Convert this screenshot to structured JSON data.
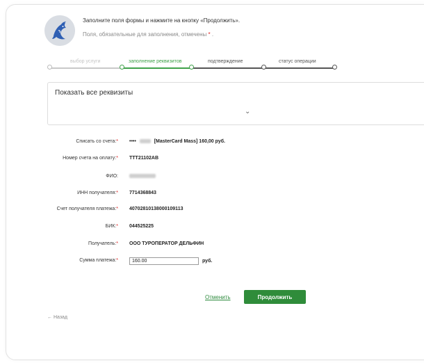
{
  "intro": {
    "line1": "Заполните поля формы и нажмите на кнопку «Продолжить».",
    "line2": "Поля, обязательные для заполнения, отмечены",
    "required_mark": "*",
    "line2_end": "."
  },
  "steps": [
    {
      "label": "выбор услуги",
      "state": "done-faded"
    },
    {
      "label": "заполнение реквизитов",
      "state": "active"
    },
    {
      "label": "подтверждение",
      "state": "todo"
    },
    {
      "label": "статус операции",
      "state": "todo"
    }
  ],
  "details_toggle": {
    "label": "Показать все реквизиты",
    "chevron": "⌄"
  },
  "fields": [
    {
      "label": "Списать со счета:",
      "required": "*",
      "prefix": "••••",
      "value": "[MasterCard Mass] 160,00   руб."
    },
    {
      "label": "Номер счета на оплату:",
      "required": "*",
      "value": "TTT21102AB"
    },
    {
      "label": "ФИО:",
      "required": "",
      "value": ""
    },
    {
      "label": "ИНН получателя:",
      "required": "*",
      "value": "7714368843"
    },
    {
      "label": "Счет получателя платежа:",
      "required": "*",
      "value": "40702810138000109113"
    },
    {
      "label": "БИК:",
      "required": "*",
      "value": "044525225"
    },
    {
      "label": "Получатель:",
      "required": "*",
      "value": "ООО ТУРОПЕРАТОР ДЕЛЬФИН"
    }
  ],
  "amount": {
    "label": "Сумма платежа:",
    "required": "*",
    "value": "160.00",
    "currency": "руб."
  },
  "actions": {
    "cancel": "Отменить",
    "continue": "Продолжить"
  },
  "back": {
    "arrow": "←",
    "label": "Назад"
  },
  "colors": {
    "accent": "#2f8c3a",
    "required": "#e02020",
    "step_active": "#3fa14a"
  }
}
